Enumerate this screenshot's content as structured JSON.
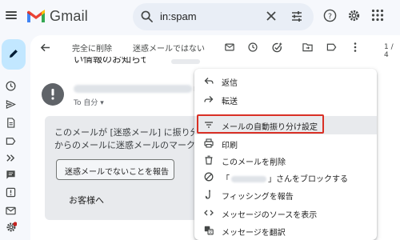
{
  "app": {
    "logo_text": "Gmail",
    "brand_colors": {
      "red": "#ea4335",
      "blue": "#4285f4",
      "green": "#34a853",
      "yellow": "#fbbc04"
    }
  },
  "search": {
    "query": "in:spam"
  },
  "rail": {
    "compose_icon": "pencil-icon",
    "icons": [
      "clock-icon",
      "send-icon",
      "file-icon",
      "label-icon",
      "forward-icon",
      "chat-icon",
      "report-icon",
      "mail-icon",
      "gear-icon"
    ]
  },
  "toolbar": {
    "delete_forever_label": "完全に削除",
    "not_spam_label": "迷惑メールではない",
    "page_count": "1 / 4"
  },
  "message": {
    "subject_partial": "い情報のお知らせ",
    "sender_suffix": "r.",
    "to_me": "To 自分 ▾",
    "warning_lines": [
      "このメールが [迷惑メール] に振り分け",
      "からのメールに迷惑メールのマークを付"
    ],
    "report_not_spam_button": "迷惑メールでないことを報告",
    "greeting": "お客様へ"
  },
  "menu": {
    "items": [
      {
        "icon": "reply-icon",
        "label": "返信"
      },
      {
        "icon": "forward-icon",
        "label": "転送"
      },
      {
        "icon": "filter-icon",
        "label": "メールの自動振り分け設定"
      },
      {
        "icon": "print-icon",
        "label": "印刷"
      },
      {
        "icon": "trash-icon",
        "label": "このメールを削除"
      },
      {
        "icon": "block-icon",
        "label_prefix": "「",
        "label_suffix": "」さんをブロックする"
      },
      {
        "icon": "phishing-icon",
        "label": "フィッシングを報告"
      },
      {
        "icon": "code-icon",
        "label": "メッセージのソースを表示"
      },
      {
        "icon": "translate-icon",
        "label": "メッセージを翻訳"
      }
    ],
    "highlight_color": "#d93025"
  }
}
